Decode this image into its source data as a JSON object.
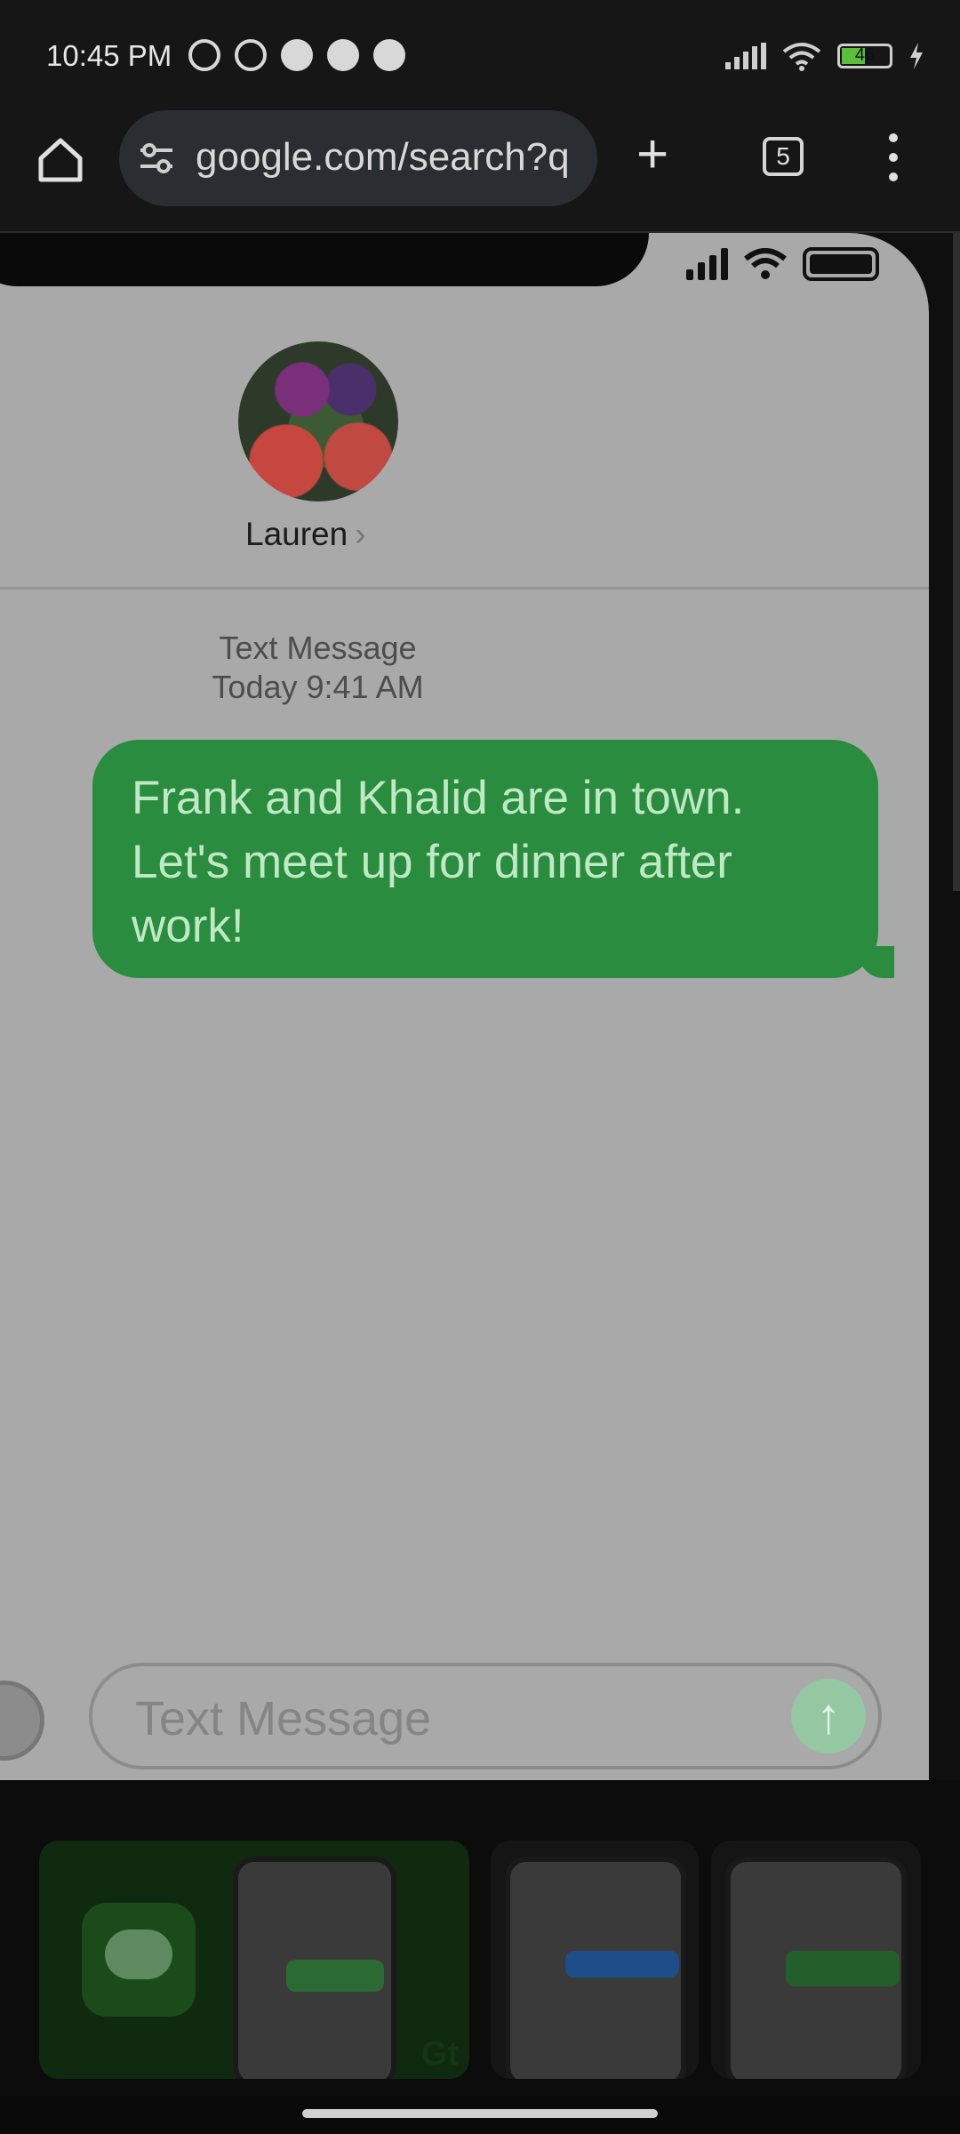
{
  "status_bar": {
    "time": "10:45 PM",
    "battery_level": "46"
  },
  "browser": {
    "url": "google.com/search?q",
    "tab_count": "5"
  },
  "image_viewer": {
    "contact_name": "Lauren",
    "message_type": "Text Message",
    "message_time": "Today 9:41 AM",
    "message_text": "Frank and Khalid are in town. Let's meet up for dinner after work!",
    "input_placeholder": "Text Message"
  },
  "thumbnails": {
    "first_badge": "Gt"
  },
  "colors": {
    "bubble_green": "#2a8c3e",
    "background": "#0a0a0a"
  }
}
